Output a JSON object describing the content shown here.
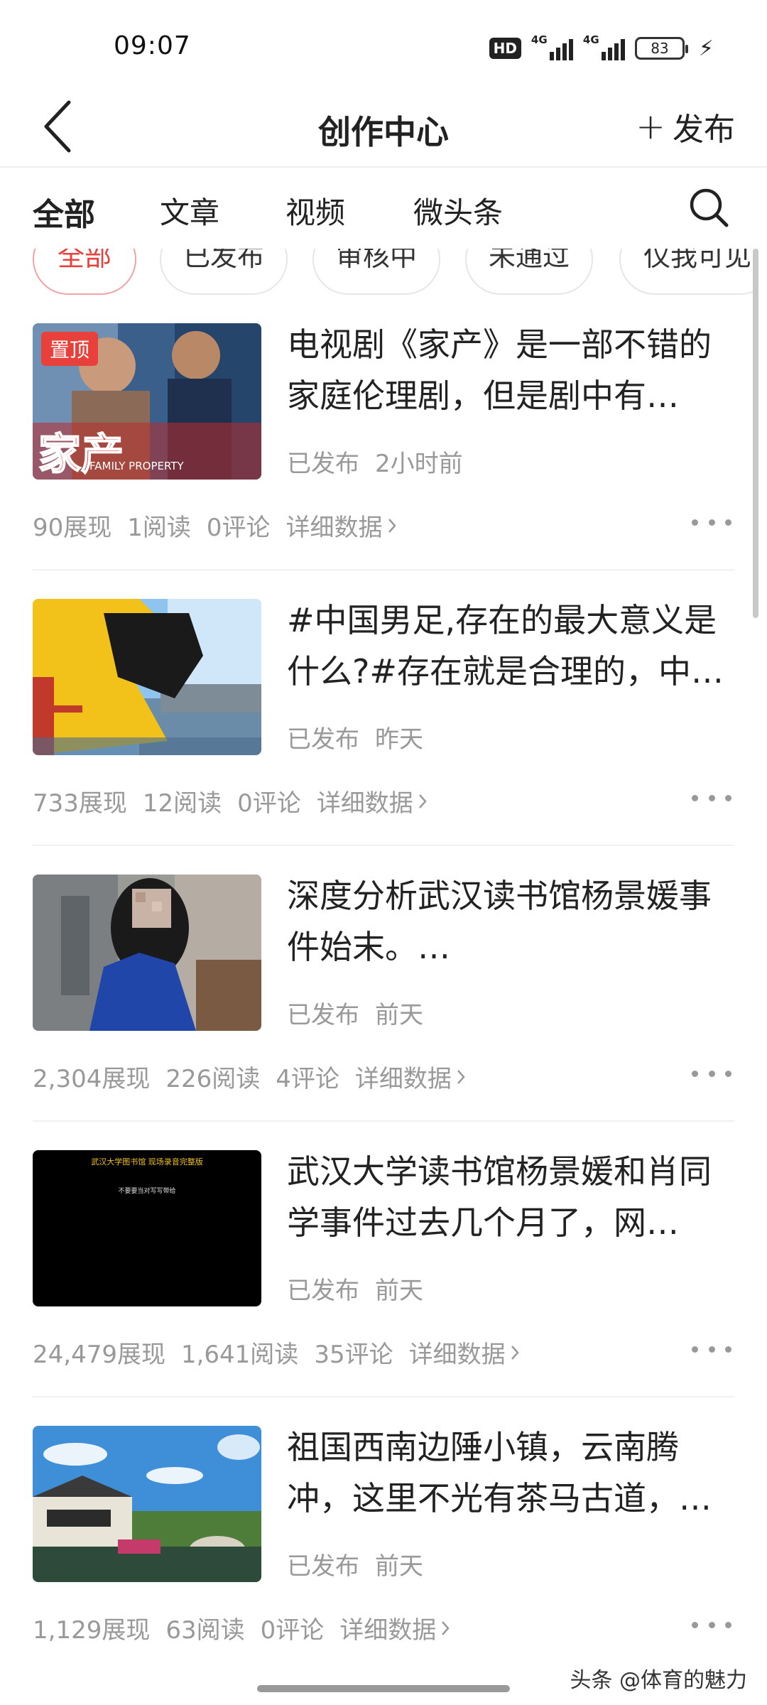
{
  "status_bar": {
    "time": "09:07",
    "hd_label": "HD",
    "signal_1_label": "4G",
    "signal_2_label": "4G",
    "battery": "83"
  },
  "header": {
    "back_icon": "chevron-left-icon",
    "title": "创作中心",
    "publish_label": "发布",
    "publish_plus": "+"
  },
  "tabs": [
    {
      "label": "全部",
      "active": true
    },
    {
      "label": "文章",
      "active": false
    },
    {
      "label": "视频",
      "active": false
    },
    {
      "label": "微头条",
      "active": false
    }
  ],
  "filters": [
    {
      "label": "全部",
      "active": true
    },
    {
      "label": "已发布",
      "active": false
    },
    {
      "label": "审核中",
      "active": false
    },
    {
      "label": "未通过",
      "active": false
    },
    {
      "label": "仅我可见",
      "active": false
    }
  ],
  "items": [
    {
      "title": "电视剧《家产》是一部不错的家庭伦理剧，但是剧中有…",
      "status": "已发布",
      "time": "2小时前",
      "pin_label": "置顶",
      "thumb_text": "家产",
      "thumb_sub": "FAMILY PROPERTY",
      "views": "90展现",
      "reads": "1阅读",
      "comments": "0评论",
      "detail": "详细数据"
    },
    {
      "title": "#中国男足,存在的最大意义是什么?#存在就是合理的，中…",
      "status": "已发布",
      "time": "昨天",
      "views": "733展现",
      "reads": "12阅读",
      "comments": "0评论",
      "detail": "详细数据"
    },
    {
      "title": "深度分析武汉读书馆杨景媛事件始末。…",
      "status": "已发布",
      "time": "前天",
      "views": "2,304展现",
      "reads": "226阅读",
      "comments": "4评论",
      "detail": "详细数据"
    },
    {
      "title": "武汉大学读书馆杨景媛和肖同学事件过去几个月了，网…",
      "status": "已发布",
      "time": "前天",
      "thumb_text": "武汉大学图书馆 现场录音完整版",
      "thumb_sub": "不要要当对写写带给",
      "views": "24,479展现",
      "reads": "1,641阅读",
      "comments": "35评论",
      "detail": "详细数据"
    },
    {
      "title": "祖国西南边陲小镇，云南腾冲，这里不光有茶马古道，…",
      "status": "已发布",
      "time": "前天",
      "views": "1,129展现",
      "reads": "63阅读",
      "comments": "0评论",
      "detail": "详细数据"
    }
  ],
  "watermark": "头条 @体育的魅力",
  "colors": {
    "accent": "#e8413b",
    "muted": "#999999"
  }
}
